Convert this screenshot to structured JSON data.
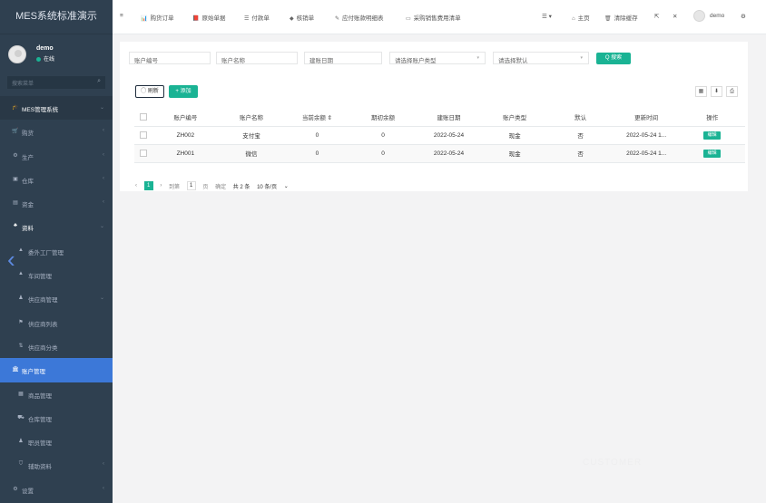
{
  "app": {
    "title": "MES系统标准演示"
  },
  "user": {
    "name": "demo",
    "status": "在线"
  },
  "sidebar": {
    "search_placeholder": "搜索菜单",
    "items": [
      {
        "icon": "graduation-cap-icon",
        "glyph": "🎓",
        "label": "MES管理系统",
        "arrow": "⌄",
        "kind": "top"
      },
      {
        "icon": "cart-icon",
        "glyph": "🛒",
        "label": "购货",
        "arrow": "‹"
      },
      {
        "icon": "gear-icon",
        "glyph": "⚙",
        "label": "生产",
        "arrow": "‹"
      },
      {
        "icon": "warehouse-icon",
        "glyph": "▣",
        "label": "仓库",
        "arrow": "‹"
      },
      {
        "icon": "money-icon",
        "glyph": "▤",
        "label": "资金",
        "arrow": "‹"
      },
      {
        "icon": "network-icon",
        "glyph": "♣",
        "label": "资料",
        "arrow": "⌄",
        "kind": "open"
      },
      {
        "icon": "factory-icon",
        "glyph": "▲",
        "label": "委外工厂管理",
        "kind": "sub"
      },
      {
        "icon": "workshop-icon",
        "glyph": "▲",
        "label": "车间管理",
        "kind": "sub"
      },
      {
        "icon": "supplier-icon",
        "glyph": "♟",
        "label": "供应商管理",
        "arrow": "⌄",
        "kind": "sub"
      },
      {
        "icon": "flag-icon",
        "glyph": "⚑",
        "label": "供应商列表",
        "kind": "sub"
      },
      {
        "icon": "sort-icon",
        "glyph": "⇅",
        "label": "供应商分类",
        "kind": "sub"
      },
      {
        "icon": "bank-icon",
        "glyph": "🏛",
        "label": "账户管理",
        "kind": "active"
      },
      {
        "icon": "product-icon",
        "glyph": "▦",
        "label": "商品管理",
        "kind": "sub"
      },
      {
        "icon": "truck-icon",
        "glyph": "⛟",
        "label": "仓库管理",
        "kind": "sub"
      },
      {
        "icon": "staff-icon",
        "glyph": "♟",
        "label": "职员管理",
        "kind": "sub"
      },
      {
        "icon": "shield-icon",
        "glyph": "⛉",
        "label": "辅助资料",
        "arrow": "‹",
        "kind": "sub"
      },
      {
        "icon": "settings-icon",
        "glyph": "⚙",
        "label": "设置",
        "arrow": "‹"
      }
    ]
  },
  "topnav": {
    "menu_glyph": "≡",
    "tabs": [
      {
        "glyph": "📊",
        "label": "购货订单"
      },
      {
        "glyph": "📕",
        "label": "原始单据"
      },
      {
        "glyph": "☰",
        "label": "付款单"
      },
      {
        "glyph": "◆",
        "label": "核销单"
      },
      {
        "glyph": "✎",
        "label": "应付账款明细表"
      },
      {
        "glyph": "▭",
        "label": "采购销售费用清单"
      }
    ],
    "right": {
      "list_glyph": "☰ ▾",
      "home_label": "主页",
      "home_glyph": "⌂",
      "clear_label": "清除缓存",
      "clear_glyph": "🗑",
      "expand_glyph": "⇱",
      "fullscreen_glyph": "✕",
      "user_label": "demo",
      "config_glyph": "⚙"
    }
  },
  "filters": {
    "account_no": "账户编号",
    "account_name": "账户名称",
    "created_date": "建账日期",
    "account_type": "请选择账户类型",
    "default": "请选择默认",
    "search_button": "Q 搜索",
    "dropdown_glyph": "▾"
  },
  "toolbar": {
    "refresh": "◯ 刷新",
    "add": "+ 添加",
    "columns_glyph": "▦",
    "export_glyph": "⬇",
    "print_glyph": "⎙"
  },
  "table": {
    "headers": [
      "",
      "账户编号",
      "账户名称",
      "当前余额 ⇕",
      "期初余额",
      "建账日期",
      "账户类型",
      "默认",
      "更新时间",
      "操作"
    ],
    "rows": [
      {
        "code": "ZH002",
        "name": "支付宝",
        "balance": "0",
        "initial": "0",
        "date": "2022-05-24",
        "type": "现金",
        "default": "否",
        "updated": "2022-05-24 1...",
        "action": "编辑"
      },
      {
        "code": "ZH001",
        "name": "微信",
        "balance": "0",
        "initial": "0",
        "date": "2022-05-24",
        "type": "现金",
        "default": "否",
        "updated": "2022-05-24 1...",
        "action": "编辑"
      }
    ]
  },
  "pager": {
    "prev": "‹",
    "current": "1",
    "next": "›",
    "goto": "到第",
    "page_input": "1",
    "page_unit": "页",
    "confirm": "确定",
    "total": "共 2 条",
    "per_page": "10 条/页",
    "per_page_arrow": "⌄"
  },
  "watermark": "CUSTOMER"
}
